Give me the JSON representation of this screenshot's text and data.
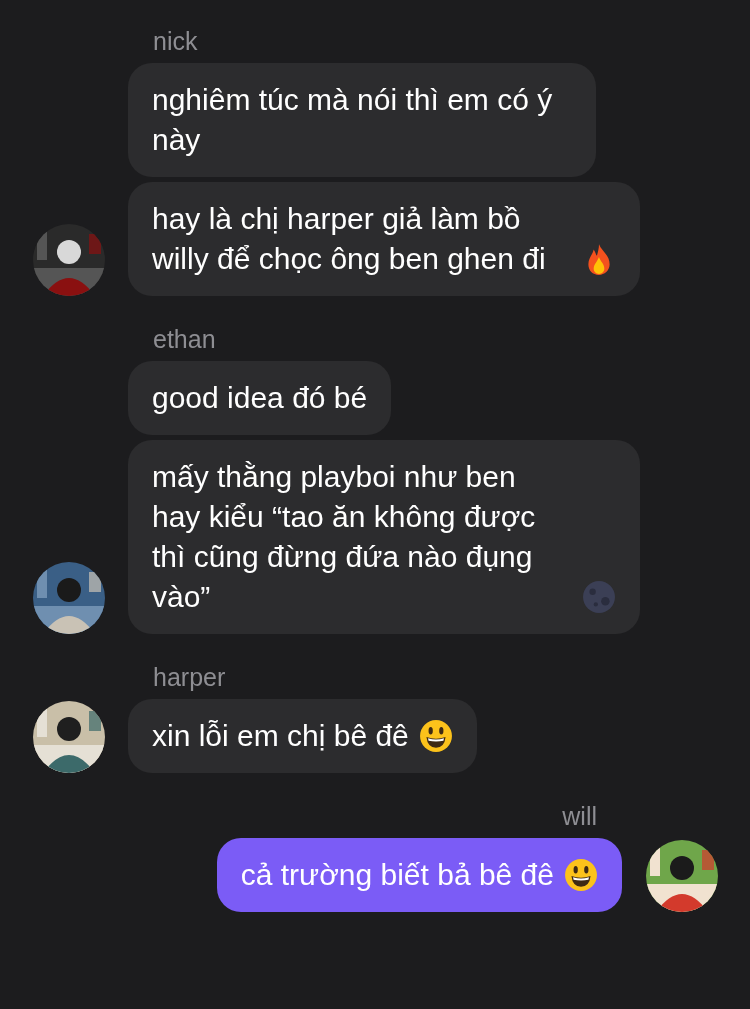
{
  "groups": [
    {
      "sender": "nick",
      "outgoing": false,
      "messages": [
        {
          "kind": "plain",
          "text": "nghiêm túc mà nói thì em có ý này"
        },
        {
          "kind": "fire",
          "text": "hay là chị harper giả làm bồ willy để chọc ông ben ghen đi"
        }
      ]
    },
    {
      "sender": "ethan",
      "outgoing": false,
      "messages": [
        {
          "kind": "plain",
          "text": "good idea đó bé"
        },
        {
          "kind": "moon",
          "text": "mấy thằng playboi như ben hay kiểu “tao ăn không được thì cũng đừng đứa nào đụng vào”"
        }
      ]
    },
    {
      "sender": "harper",
      "outgoing": false,
      "messages": [
        {
          "kind": "smile",
          "text": "xin lỗi em chị bê đê"
        }
      ]
    },
    {
      "sender": "will",
      "outgoing": true,
      "messages": [
        {
          "kind": "smile",
          "text": "cả trường biết bả bê đê"
        }
      ]
    }
  ]
}
